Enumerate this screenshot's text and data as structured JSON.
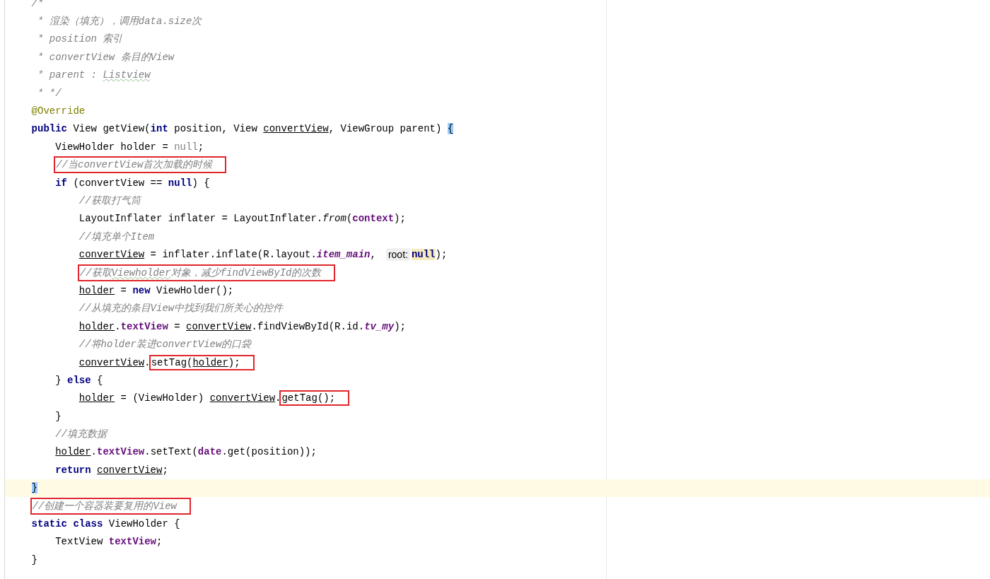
{
  "editor": {
    "lines": [
      {
        "current": false,
        "segments": [
          {
            "kind": "code",
            "tokens": [
              {
                "text": "/*",
                "kind": "comment"
              }
            ]
          }
        ]
      },
      {
        "current": false,
        "segments": [
          {
            "kind": "code",
            "tokens": [
              {
                "text": " * 渲染（填充），调用data.size次",
                "kind": "comment"
              }
            ]
          }
        ]
      },
      {
        "current": false,
        "segments": [
          {
            "kind": "code",
            "tokens": [
              {
                "text": " * position 索引",
                "kind": "comment"
              }
            ]
          }
        ]
      },
      {
        "current": false,
        "segments": [
          {
            "kind": "code",
            "tokens": [
              {
                "text": " * convertView 条目的View",
                "kind": "comment"
              }
            ]
          }
        ]
      },
      {
        "current": false,
        "segments": [
          {
            "kind": "code",
            "tokens": [
              {
                "text": " * parent : ",
                "kind": "comment"
              },
              {
                "text": "Listview",
                "kind": "comment",
                "typo": true
              }
            ]
          }
        ]
      },
      {
        "current": false,
        "segments": [
          {
            "kind": "code",
            "tokens": [
              {
                "text": " * */",
                "kind": "comment"
              }
            ]
          }
        ]
      },
      {
        "current": false,
        "segments": [
          {
            "kind": "code",
            "tokens": [
              {
                "text": "@Override",
                "kind": "annotation"
              }
            ]
          }
        ]
      },
      {
        "current": false,
        "segments": [
          {
            "kind": "code",
            "tokens": [
              {
                "text": "public",
                "kind": "keyword"
              },
              {
                "text": " View getView(",
                "kind": "plain"
              },
              {
                "text": "int",
                "kind": "keyword"
              },
              {
                "text": " position, View ",
                "kind": "plain"
              },
              {
                "text": "convertView",
                "kind": "plain",
                "underline": true
              },
              {
                "text": ", ViewGroup parent) ",
                "kind": "plain"
              },
              {
                "text": "{",
                "kind": "brace-match"
              }
            ]
          }
        ],
        "children": [
          {
            "current": false,
            "segments": [
              {
                "kind": "code",
                "tokens": [
                  {
                    "text": "ViewHolder holder = ",
                    "kind": "plain"
                  },
                  {
                    "text": "null",
                    "kind": "unused"
                  },
                  {
                    "text": ";",
                    "kind": "plain"
                  }
                ]
              }
            ]
          },
          {
            "current": false,
            "segments": [
              {
                "kind": "boxed",
                "tokens": [
                  {
                    "text": "//当convertView首次加载的时候",
                    "kind": "comment"
                  }
                ]
              }
            ]
          },
          {
            "current": false,
            "segments": [
              {
                "kind": "code",
                "tokens": [
                  {
                    "text": "if",
                    "kind": "keyword"
                  },
                  {
                    "text": " (convertView == ",
                    "kind": "plain"
                  },
                  {
                    "text": "null",
                    "kind": "keyword"
                  },
                  {
                    "text": ") {",
                    "kind": "plain"
                  }
                ]
              }
            ],
            "children": [
              {
                "current": false,
                "segments": [
                  {
                    "kind": "code",
                    "tokens": [
                      {
                        "text": "//获取打气筒",
                        "kind": "comment"
                      }
                    ]
                  }
                ]
              },
              {
                "current": false,
                "segments": [
                  {
                    "kind": "code",
                    "tokens": [
                      {
                        "text": "LayoutInflater inflater = LayoutInflater.",
                        "kind": "plain"
                      },
                      {
                        "text": "from",
                        "kind": "static-method"
                      },
                      {
                        "text": "(",
                        "kind": "plain"
                      },
                      {
                        "text": "context",
                        "kind": "field"
                      },
                      {
                        "text": ");",
                        "kind": "plain"
                      }
                    ]
                  }
                ]
              },
              {
                "current": false,
                "segments": [
                  {
                    "kind": "code",
                    "tokens": [
                      {
                        "text": "//填充单个Item",
                        "kind": "comment"
                      }
                    ]
                  }
                ]
              },
              {
                "current": false,
                "segments": [
                  {
                    "kind": "code",
                    "tokens": [
                      {
                        "text": "convertView",
                        "kind": "plain",
                        "underline": true
                      },
                      {
                        "text": " = inflater.inflate(R.layout.",
                        "kind": "plain"
                      },
                      {
                        "text": "item_main",
                        "kind": "static-field"
                      },
                      {
                        "text": ",",
                        "kind": "plain"
                      }
                    ]
                  },
                  {
                    "kind": "hint",
                    "tokens": [
                      {
                        "text": "root:",
                        "kind": "plain"
                      }
                    ]
                  },
                  {
                    "kind": "code",
                    "tokens": [
                      {
                        "text": "null",
                        "kind": "marked"
                      },
                      {
                        "text": ");",
                        "kind": "plain"
                      }
                    ]
                  }
                ]
              },
              {
                "current": false,
                "segments": [
                  {
                    "kind": "boxed",
                    "tokens": [
                      {
                        "text": "//获取",
                        "kind": "comment"
                      },
                      {
                        "text": "Viewholder",
                        "kind": "comment",
                        "typo": true
                      },
                      {
                        "text": "对象，减少findViewById的次数",
                        "kind": "comment"
                      }
                    ]
                  }
                ]
              },
              {
                "current": false,
                "segments": [
                  {
                    "kind": "code",
                    "tokens": [
                      {
                        "text": "holder",
                        "kind": "plain",
                        "underline": true
                      },
                      {
                        "text": " = ",
                        "kind": "plain"
                      },
                      {
                        "text": "new",
                        "kind": "keyword"
                      },
                      {
                        "text": " ViewHolder();",
                        "kind": "plain"
                      }
                    ]
                  }
                ]
              },
              {
                "current": false,
                "segments": [
                  {
                    "kind": "code",
                    "tokens": [
                      {
                        "text": "//从填充的条目View中找到我们所关心的控件",
                        "kind": "comment"
                      }
                    ]
                  }
                ]
              },
              {
                "current": false,
                "segments": [
                  {
                    "kind": "code",
                    "tokens": [
                      {
                        "text": "holder",
                        "kind": "plain",
                        "underline": true
                      },
                      {
                        "text": ".",
                        "kind": "plain"
                      },
                      {
                        "text": "textView",
                        "kind": "field"
                      },
                      {
                        "text": " = ",
                        "kind": "plain"
                      },
                      {
                        "text": "convertView",
                        "kind": "plain",
                        "underline": true
                      },
                      {
                        "text": ".findViewById(R.id.",
                        "kind": "plain"
                      },
                      {
                        "text": "tv_my",
                        "kind": "static-field"
                      },
                      {
                        "text": ");",
                        "kind": "plain"
                      }
                    ]
                  }
                ]
              },
              {
                "current": false,
                "segments": [
                  {
                    "kind": "code",
                    "tokens": [
                      {
                        "text": "//将holder装进convertView的口袋",
                        "kind": "comment"
                      }
                    ]
                  }
                ]
              },
              {
                "current": false,
                "segments": [
                  {
                    "kind": "code",
                    "tokens": [
                      {
                        "text": "convertView",
                        "kind": "plain",
                        "underline": true
                      },
                      {
                        "text": ".",
                        "kind": "plain"
                      }
                    ]
                  },
                  {
                    "kind": "boxed",
                    "tokens": [
                      {
                        "text": "setTag(",
                        "kind": "plain"
                      },
                      {
                        "text": "holder",
                        "kind": "plain",
                        "underline": true
                      },
                      {
                        "text": ");",
                        "kind": "plain"
                      }
                    ]
                  }
                ]
              }
            ]
          },
          {
            "current": false,
            "segments": [
              {
                "kind": "code",
                "tokens": [
                  {
                    "text": "} ",
                    "kind": "plain"
                  },
                  {
                    "text": "else",
                    "kind": "keyword"
                  },
                  {
                    "text": " {",
                    "kind": "plain"
                  }
                ]
              }
            ],
            "children": [
              {
                "current": false,
                "segments": [
                  {
                    "kind": "code",
                    "tokens": [
                      {
                        "text": "holder",
                        "kind": "plain",
                        "underline": true
                      },
                      {
                        "text": " = (ViewHolder) ",
                        "kind": "plain"
                      },
                      {
                        "text": "convertView",
                        "kind": "plain",
                        "underline": true
                      },
                      {
                        "text": ".",
                        "kind": "plain"
                      }
                    ]
                  },
                  {
                    "kind": "boxed",
                    "tokens": [
                      {
                        "text": "getTag();",
                        "kind": "plain"
                      }
                    ]
                  }
                ]
              }
            ]
          },
          {
            "current": false,
            "segments": [
              {
                "kind": "code",
                "tokens": [
                  {
                    "text": "}",
                    "kind": "plain"
                  }
                ]
              }
            ]
          },
          {
            "current": false,
            "segments": [
              {
                "kind": "code",
                "tokens": [
                  {
                    "text": "//填充数据",
                    "kind": "comment"
                  }
                ]
              }
            ]
          },
          {
            "current": false,
            "segments": [
              {
                "kind": "code",
                "tokens": [
                  {
                    "text": "holder",
                    "kind": "plain",
                    "underline": true
                  },
                  {
                    "text": ".",
                    "kind": "plain"
                  },
                  {
                    "text": "textView",
                    "kind": "field"
                  },
                  {
                    "text": ".setText(",
                    "kind": "plain"
                  },
                  {
                    "text": "date",
                    "kind": "field"
                  },
                  {
                    "text": ".get(position));",
                    "kind": "plain"
                  }
                ]
              }
            ]
          },
          {
            "current": false,
            "segments": [
              {
                "kind": "code",
                "tokens": [
                  {
                    "text": "return ",
                    "kind": "keyword"
                  },
                  {
                    "text": "convertView",
                    "kind": "plain",
                    "underline": true
                  },
                  {
                    "text": ";",
                    "kind": "plain"
                  }
                ]
              }
            ]
          }
        ]
      },
      {
        "current": true,
        "segments": [
          {
            "kind": "code",
            "tokens": [
              {
                "text": "}",
                "kind": "brace-match"
              }
            ]
          }
        ]
      },
      {
        "current": false,
        "segments": [
          {
            "kind": "boxed",
            "tokens": [
              {
                "text": "//创建一个容器装要复用的View",
                "kind": "comment"
              }
            ]
          }
        ]
      },
      {
        "current": false,
        "segments": [
          {
            "kind": "code",
            "tokens": [
              {
                "text": "static class",
                "kind": "keyword"
              },
              {
                "text": " ViewHolder {",
                "kind": "plain"
              }
            ]
          }
        ],
        "children": [
          {
            "current": false,
            "segments": [
              {
                "kind": "code",
                "tokens": [
                  {
                    "text": "TextView ",
                    "kind": "plain"
                  },
                  {
                    "text": "textView",
                    "kind": "field"
                  },
                  {
                    "text": ";",
                    "kind": "plain"
                  }
                ]
              }
            ]
          }
        ]
      },
      {
        "current": false,
        "segments": [
          {
            "kind": "code",
            "tokens": [
              {
                "text": "}",
                "kind": "plain"
              }
            ]
          }
        ]
      }
    ]
  }
}
